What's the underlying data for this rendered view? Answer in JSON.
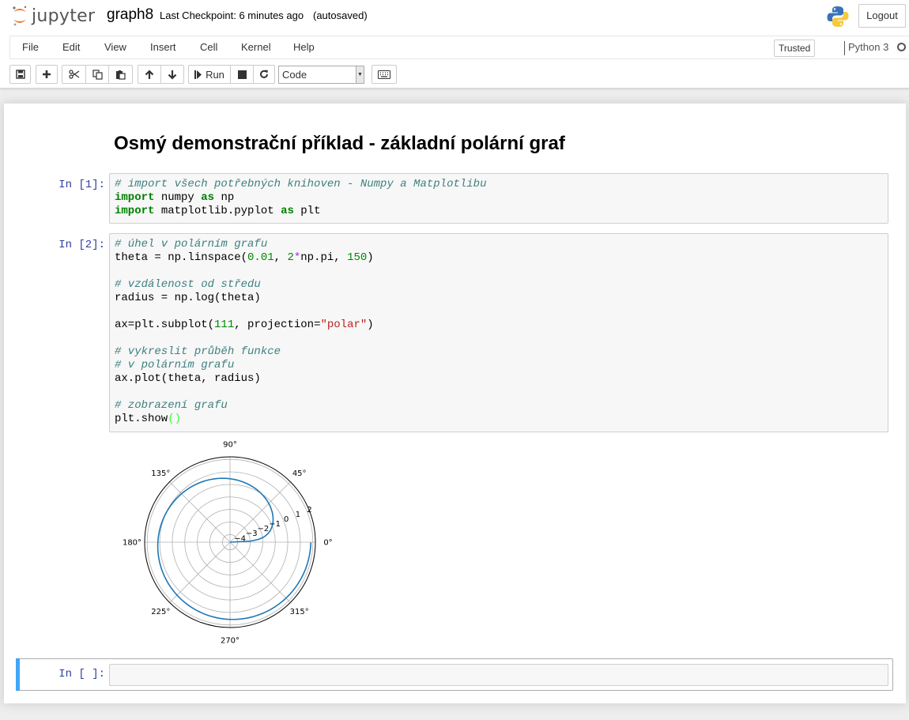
{
  "header": {
    "logo_text": "jupyter",
    "notebook_name": "graph8",
    "checkpoint": "Last Checkpoint: 6 minutes ago",
    "autosave": "(autosaved)",
    "logout_label": "Logout"
  },
  "menubar": {
    "items": [
      "File",
      "Edit",
      "View",
      "Insert",
      "Cell",
      "Kernel",
      "Help"
    ],
    "trusted_label": "Trusted",
    "kernel_name": "Python 3"
  },
  "toolbar": {
    "run_label": "Run",
    "cell_type": "Code",
    "icons": [
      "save-icon",
      "plus-icon",
      "scissors-icon",
      "copy-icon",
      "paste-icon",
      "arrow-up-icon",
      "arrow-down-icon",
      "step-forward-icon",
      "stop-icon",
      "refresh-icon",
      "keyboard-icon"
    ]
  },
  "notebook": {
    "heading": "Osmý demonstrační příklad - základní polární graf",
    "cells": [
      {
        "prompt": "In [1]:",
        "lines": [
          "# import všech potřebných knihoven - Numpy a Matplotlibu",
          "import numpy as np",
          "import matplotlib.pyplot as plt"
        ]
      },
      {
        "prompt": "In [2]:",
        "lines": [
          "# úhel v polárním grafu",
          "theta = np.linspace(0.01, 2*np.pi, 150)",
          "",
          "# vzdálenost od středu",
          "radius = np.log(theta)",
          "",
          "ax=plt.subplot(111, projection=\"polar\")",
          "",
          "# vykreslit průběh funkce",
          "# v polárním grafu",
          "ax.plot(theta, radius)",
          "",
          "# zobrazení grafu",
          "plt.show()"
        ]
      },
      {
        "prompt": "In [ ]:",
        "lines": []
      }
    ]
  },
  "chart_data": {
    "type": "line",
    "projection": "polar",
    "x": [
      0.01,
      0.5,
      1.0,
      1.5,
      2.0,
      2.5,
      3.0,
      3.5,
      4.0,
      4.5,
      5.0,
      5.5,
      6.0,
      6.28
    ],
    "series": [
      {
        "values": [
          -4.61,
          -0.69,
          0.0,
          0.41,
          0.69,
          0.92,
          1.1,
          1.25,
          1.39,
          1.5,
          1.61,
          1.7,
          1.79,
          1.84
        ],
        "color": "#1f77b4"
      }
    ],
    "angle_ticks": [
      "0°",
      "45°",
      "90°",
      "135°",
      "180°",
      "225°",
      "270°",
      "315°"
    ],
    "radial_ticks": [
      "−4",
      "−3",
      "−2",
      "−1",
      "0",
      "1",
      "2"
    ],
    "rlim": [
      -4.61,
      2.2
    ],
    "grid": true
  }
}
